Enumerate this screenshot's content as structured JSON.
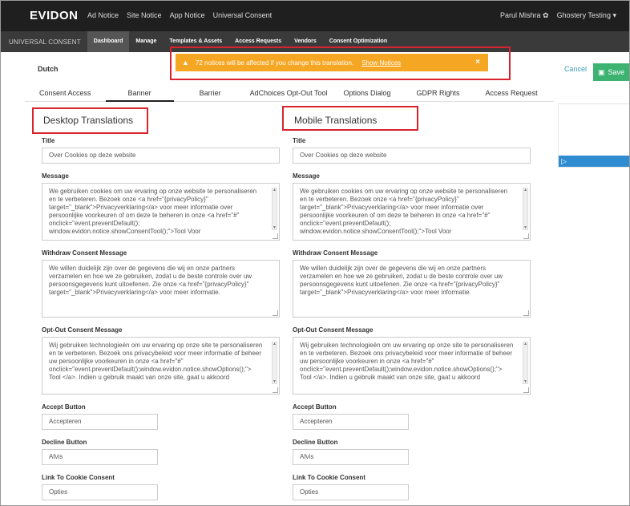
{
  "brand": "EVIDON",
  "topnav": [
    "Ad Notice",
    "Site Notice",
    "App Notice",
    "Universal Consent"
  ],
  "user": "Parul Mishra",
  "account": "Ghostery Testing",
  "subnav": {
    "brand": "UNIVERSAL CONSENT",
    "items": [
      "Dashboard",
      "Manage",
      "Templates & Assets",
      "Access Requests",
      "Vendors",
      "Consent Optimization"
    ]
  },
  "language": "Dutch",
  "alert": {
    "text": "72 notices will be affected if you change this translation.",
    "link": "Show Notices",
    "close": "×"
  },
  "actions": {
    "cancel": "Cancel",
    "save": "Save"
  },
  "tabs": [
    "Consent Access",
    "Banner",
    "Barrier",
    "AdChoices Opt-Out Tool",
    "Options Dialog",
    "GDPR Rights",
    "Access Request"
  ],
  "labels": {
    "title": "Title",
    "message": "Message",
    "withdraw": "Withdraw Consent Message",
    "optout": "Opt-Out Consent Message",
    "accept": "Accept Button",
    "decline": "Decline Button",
    "link": "Link To Cookie Consent"
  },
  "desktop": {
    "heading": "Desktop Translations",
    "title": "Over Cookies op deze website",
    "message": "We gebruiken cookies om uw ervaring op onze website te personaliseren en te verbeteren. Bezoek onze <a href=\"{privacyPolicy}\" target=\"_blank\">Privacyverklaring</a> voor meer informatie over persoonlijke voorkeuren of om deze te beheren in onze <a href=\"#\" onclick=\"event.preventDefault(); window.evidon.notice.showConsentTool();\">Tool Voor",
    "withdraw": "We willen duidelijk zijn over de gegevens die wij en onze partners verzamelen en hoe we ze gebruiken, zodat u de beste controle over uw persoonsgegevens kunt uitoefenen. Zie onze <a href=\"{privacyPolicy}\" target=\"_blank\">Privacyverklaring</a> voor meer informatie.",
    "optout": "Wij gebruiken technologieën om uw ervaring op onze site te personaliseren en te verbeteren. Bezoek ons privacybeleid voor meer informatie of beheer uw persoonlijke voorkeuren in onze <a href=\"#\" onclick=\"event.preventDefault();window.evidon.notice.showOptions();\"> Tool </a>. Indien u gebruik maakt van onze site, gaat u akkoord",
    "accept": "Accepteren",
    "decline": "Afvis",
    "link": "Opties"
  },
  "mobile": {
    "heading": "Mobile Translations",
    "title": "Over Cookies op deze website",
    "message": "We gebruiken cookies om uw ervaring op onze website te personaliseren en te verbeteren. Bezoek onze <a href=\"{privacyPolicy}\" target=\"_blank\">Privacyverklaring</a> voor meer informatie over persoonlijke voorkeuren of om deze te beheren in onze <a href=\"#\" onclick=\"event.preventDefault(); window.evidon.notice.showConsentTool();\">Tool Voor",
    "withdraw": "We willen duidelijk zijn over de gegevens die wij en onze partners verzamelen en hoe we ze gebruiken, zodat u de beste controle over uw persoonsgegevens kunt uitoefenen. Zie onze <a href=\"{privacyPolicy}\" target=\"_blank\">Privacyverklaring</a> voor meer informatie.",
    "optout": "Wij gebruiken technologieën om uw ervaring op onze site te personaliseren en te verbeteren. Bezoek ons privacybeleid voor meer informatie of beheer uw persoonlijke voorkeuren in onze <a href=\"#\" onclick=\"event.preventDefault();window.evidon.notice.showOptions();\"> Tool </a>. Indien u gebruik maakt van onze site, gaat u akkoord",
    "accept": "Accepteren",
    "decline": "Afvis",
    "link": "Opties"
  },
  "colors": {
    "alert": "#f5a623",
    "save": "#3cb371",
    "highlight": "#d9232e"
  }
}
